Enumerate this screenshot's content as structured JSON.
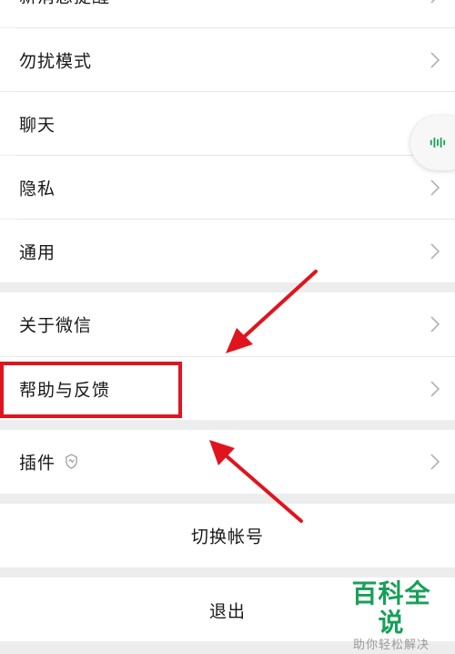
{
  "menu": {
    "top_partial_label": "新消息提醒",
    "dnd": "勿扰模式",
    "chat": "聊天",
    "privacy": "隐私",
    "general": "通用",
    "about": "关于微信",
    "help": "帮助与反馈",
    "plugins": "插件"
  },
  "actions": {
    "switch_account": "切换帐号",
    "logout": "退出"
  },
  "watermark": {
    "title": "百科全说",
    "subtitle": "助你轻松解决"
  },
  "colors": {
    "annotation_red": "#e0141e",
    "accent_green": "#18a058"
  },
  "icons": {
    "chevron": "chevron-right-icon",
    "plugin_badge": "plugin-shield-icon",
    "floating": "audio-wave-icon"
  }
}
